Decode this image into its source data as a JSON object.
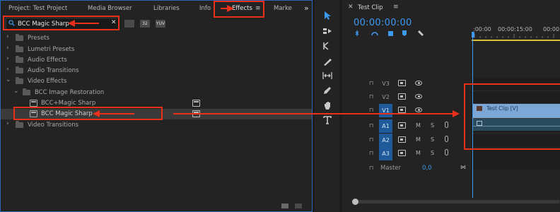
{
  "colors": {
    "accent": "#3d9af2",
    "annotation": "#e8301a",
    "selected_track": "#1f5b9a",
    "video_clip": "#7aa7d6"
  },
  "effects_panel": {
    "tabs": [
      {
        "label": "Project: Test Project"
      },
      {
        "label": "Media Browser"
      },
      {
        "label": "Libraries"
      },
      {
        "label": "Info"
      },
      {
        "label": "Effects",
        "active": true
      },
      {
        "label": "Marke"
      }
    ],
    "more_glyph": "»",
    "menu_glyph": "≡",
    "search": {
      "value": "BCC Magic Sharp",
      "clear_glyph": "✕",
      "icon": "search-icon"
    },
    "filter_buttons": [
      {
        "label": ""
      },
      {
        "label": "32"
      },
      {
        "label": "YUV"
      }
    ],
    "tree": [
      {
        "label": "Presets",
        "expanded": false
      },
      {
        "label": "Lumetri Presets",
        "expanded": false
      },
      {
        "label": "Audio Effects",
        "expanded": false
      },
      {
        "label": "Audio Transitions",
        "expanded": false
      },
      {
        "label": "Video Effects",
        "expanded": true
      },
      {
        "label": "BCC Image Restoration",
        "expanded": true
      },
      {
        "label": "BCC+Magic Sharp",
        "selected": false
      },
      {
        "label": "BCC Magic Sharp",
        "selected": true
      },
      {
        "label": "Video Transitions",
        "expanded": false
      }
    ]
  },
  "tools": [
    {
      "name": "selection-tool"
    },
    {
      "name": "track-select-tool"
    },
    {
      "name": "ripple-edit-tool"
    },
    {
      "name": "razor-tool"
    },
    {
      "name": "slip-tool"
    },
    {
      "name": "pen-tool"
    },
    {
      "name": "hand-tool"
    },
    {
      "name": "type-tool"
    }
  ],
  "timeline": {
    "title": "Test Clip",
    "close_glyph": "✕",
    "menu_glyph": "≡",
    "timecode": "00:00:00:00",
    "ruler": [
      ":00:00",
      "00:00:15:00",
      "00:00:30:00"
    ],
    "tracks": [
      {
        "name": "V3",
        "type": "video",
        "targeted": false
      },
      {
        "name": "V2",
        "type": "video",
        "targeted": false
      },
      {
        "name": "V1",
        "type": "video",
        "targeted": true
      },
      {
        "name": "A1",
        "type": "audio",
        "targeted": true
      },
      {
        "name": "A2",
        "type": "audio",
        "targeted": true
      },
      {
        "name": "A3",
        "type": "audio",
        "targeted": true
      }
    ],
    "mute_label": "M",
    "solo_label": "S",
    "master_label": "Master",
    "master_value": "0,0",
    "video_clip_label": "Test Clip [V]"
  }
}
